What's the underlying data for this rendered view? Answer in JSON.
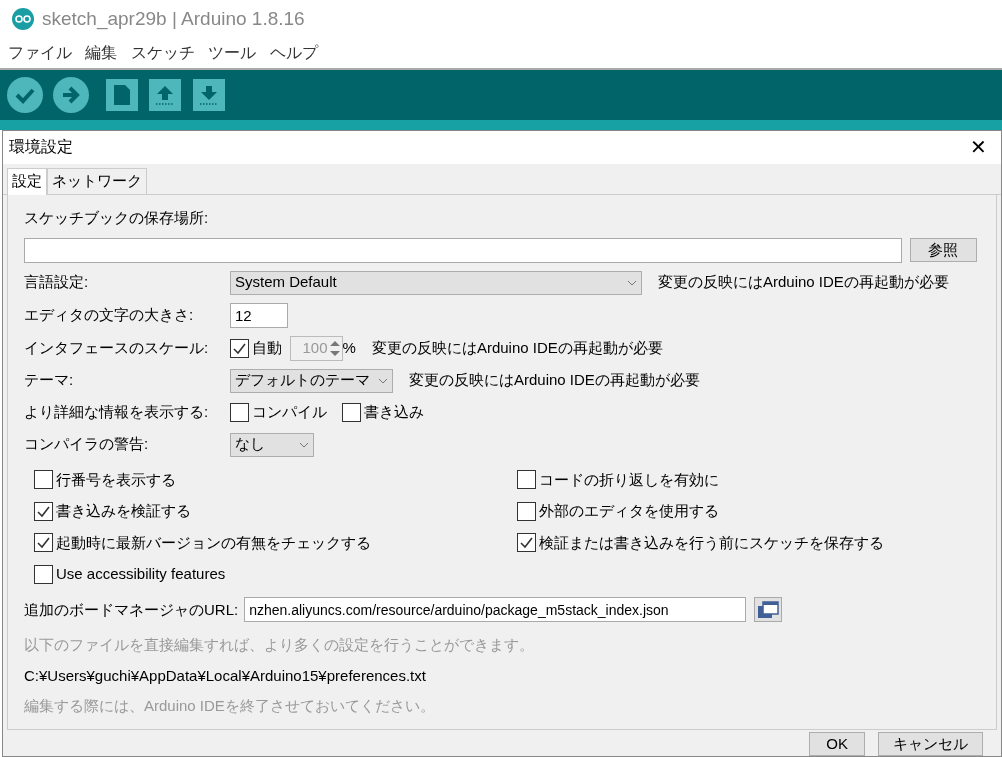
{
  "app": {
    "title": "sketch_apr29b | Arduino 1.8.16",
    "menu": [
      "ファイル",
      "編集",
      "スケッチ",
      "ツール",
      "ヘルプ"
    ]
  },
  "dialog": {
    "title": "環境設定",
    "close": "✕",
    "tabs": [
      {
        "label": "設定",
        "selected": true
      },
      {
        "label": "ネットワーク",
        "selected": false
      }
    ],
    "sketchbook": {
      "label": "スケッチブックの保存場所:",
      "browse": "参照"
    },
    "language": {
      "label": "言語設定:",
      "value": "System Default",
      "note": "変更の反映にはArduino IDEの再起動が必要"
    },
    "font_size": {
      "label": "エディタの文字の大きさ:",
      "value": "12"
    },
    "scale": {
      "label": "インタフェースのスケール:",
      "auto_label": "自動",
      "auto_checked": true,
      "value": "100",
      "disabled": true,
      "unit": "%",
      "note": "変更の反映にはArduino IDEの再起動が必要"
    },
    "theme": {
      "label": "テーマ:",
      "value": "デフォルトのテーマ",
      "note": "変更の反映にはArduino IDEの再起動が必要"
    },
    "verbose": {
      "label": "より詳細な情報を表示する:",
      "options": [
        {
          "label": "コンパイル",
          "checked": false
        },
        {
          "label": "書き込み",
          "checked": false
        }
      ]
    },
    "warnings": {
      "label": "コンパイラの警告:",
      "value": "なし"
    },
    "options": [
      {
        "label": "行番号を表示する",
        "checked": false
      },
      {
        "label": "コードの折り返しを有効に",
        "checked": false
      },
      {
        "label": "書き込みを検証する",
        "checked": true
      },
      {
        "label": "外部のエディタを使用する",
        "checked": false
      },
      {
        "label": "起動時に最新バージョンの有無をチェックする",
        "checked": true
      },
      {
        "label": "検証または書き込みを行う前にスケッチを保存する",
        "checked": true
      },
      {
        "label": "Use accessibility features",
        "checked": false
      }
    ],
    "board_urls": {
      "label": "追加のボードマネージャのURL:",
      "value": "nzhen.aliyuncs.com/resource/arduino/package_m5stack_index.json"
    },
    "info": "以下のファイルを直接編集すれば、より多くの設定を行うことができます。",
    "prefs_path": "C:¥Users¥guchi¥AppData¥Local¥Arduino15¥preferences.txt",
    "edit_note": "編集する際には、Arduino IDEを終了させておいてください。",
    "buttons": [
      "OK",
      "キャンセル"
    ]
  }
}
